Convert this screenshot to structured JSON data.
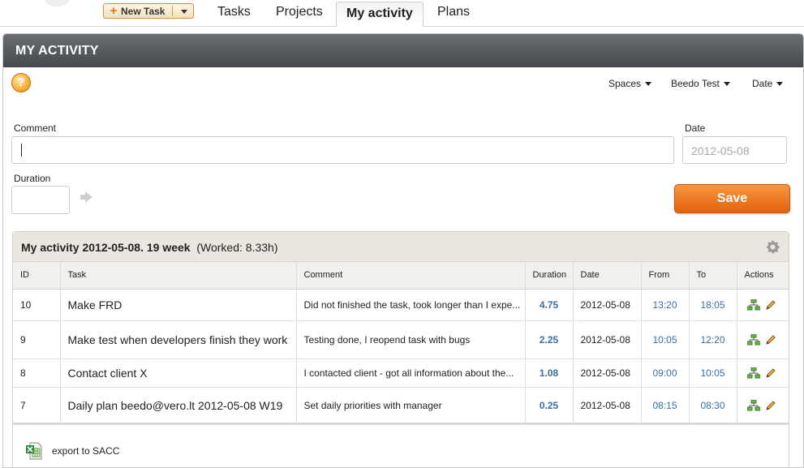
{
  "topnav": {
    "new_task_label": "New Task",
    "tabs": [
      {
        "label": "Tasks"
      },
      {
        "label": "Projects"
      },
      {
        "label": "My activity"
      },
      {
        "label": "Plans"
      }
    ]
  },
  "panel": {
    "title": "MY ACTIVITY",
    "filters": [
      "Spaces",
      "Beedo Test",
      "Date"
    ]
  },
  "form": {
    "comment_label": "Comment",
    "comment_value": "",
    "date_label": "Date",
    "date_value": "2012-05-08",
    "duration_label": "Duration",
    "duration_value": "",
    "save_label": "Save"
  },
  "activity": {
    "heading": "My activity 2012-05-08. 19 week",
    "worked": "(Worked: 8.33h)",
    "columns": [
      "ID",
      "Task",
      "Comment",
      "Duration",
      "Date",
      "From",
      "To",
      "Actions"
    ],
    "rows": [
      {
        "id": "10",
        "task": "Make FRD",
        "comment": "Did not finished the task, took longer than I expe...",
        "duration": "4.75",
        "date": "2012-05-08",
        "from": "13:20",
        "to": "18:05"
      },
      {
        "id": "9",
        "task": "Make test when developers finish they work",
        "comment": "Testing done, I reopend task with bugs",
        "duration": "2.25",
        "date": "2012-05-08",
        "from": "10:05",
        "to": "12:20"
      },
      {
        "id": "8",
        "task": "Contact client X",
        "comment": "I contacted client - got all information about the...",
        "duration": "1.08",
        "date": "2012-05-08",
        "from": "09:00",
        "to": "10:05"
      },
      {
        "id": "7",
        "task": "Daily plan beedo@vero.lt 2012-05-08 W19",
        "comment": "Set daily priorities with manager",
        "duration": "0.25",
        "date": "2012-05-08",
        "from": "08:15",
        "to": "08:30"
      }
    ],
    "export_label": "export to SACC"
  },
  "colors": {
    "accent_orange": "#e86a10",
    "header_dark": "#4f5358",
    "link_blue": "#3a6ea5"
  }
}
